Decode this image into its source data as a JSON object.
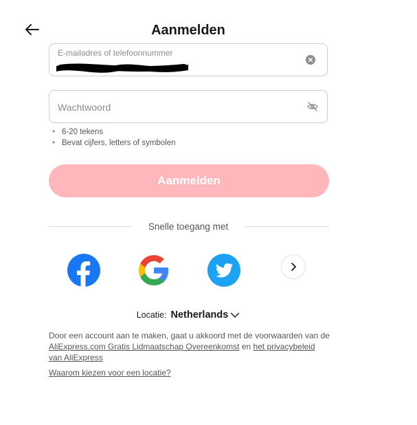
{
  "header": {
    "title": "Aanmelden",
    "back_icon": "arrow-left-icon"
  },
  "email_field": {
    "label": "E-mailadres of telefoonnummer",
    "value_redacted": true,
    "clear_icon": "clear-circle-icon"
  },
  "password_field": {
    "placeholder": "Wachtwoord",
    "value": "",
    "visibility_icon": "eye-off-icon"
  },
  "password_hints": [
    "6-20 tekens",
    "Bevat cijfers, letters of symbolen"
  ],
  "login_button": {
    "label": "Aanmelden",
    "background": "#ffb7bb",
    "color": "#ffffff"
  },
  "quick_access": {
    "label": "Snelle toegang met",
    "providers": [
      {
        "name": "facebook-icon",
        "color": "#1877f2"
      },
      {
        "name": "google-icon",
        "color": "#4285f4"
      },
      {
        "name": "twitter-icon",
        "color": "#1da1f2"
      }
    ],
    "more_icon": "chevron-right-icon"
  },
  "location": {
    "label": "Locatie:",
    "value": "Netherlands",
    "chevron_icon": "chevron-down-icon"
  },
  "terms": {
    "prefix": "Door een account aan te maken, gaat u akkoord met de voorwaarden van de ",
    "link1": "AliExpress.com Gratis Lidmaatschap Overeenkomst",
    "middle": " en ",
    "link2": "het privacybeleid van AliExpress"
  },
  "why_location_link": "Waarom kiezen voor een locatie?"
}
